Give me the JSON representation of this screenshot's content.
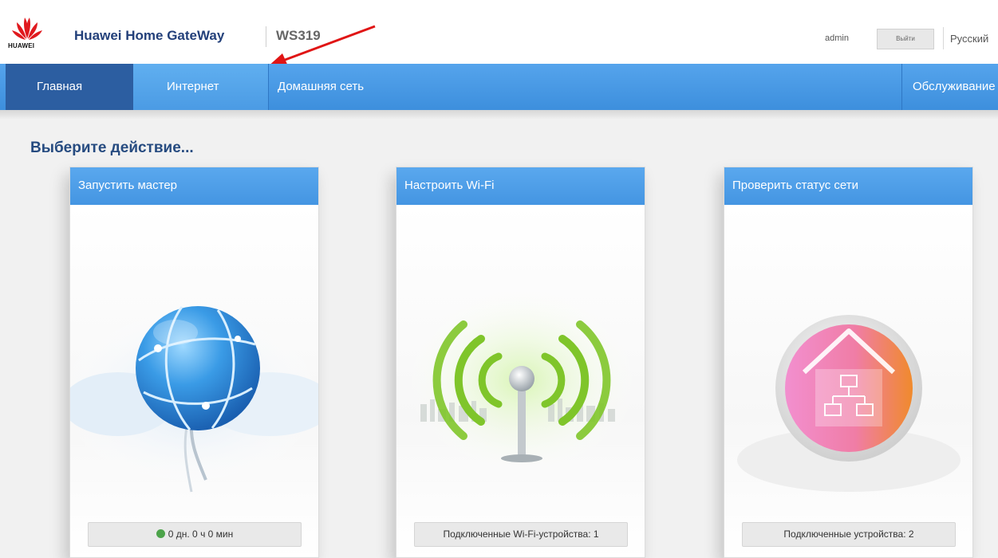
{
  "header": {
    "brand_title": "Huawei Home GateWay",
    "model": "WS319",
    "logo_text": "HUAWEI",
    "user": "admin",
    "logout_label": "Выйти",
    "language": "Русский"
  },
  "nav": {
    "items": [
      {
        "label": "Главная",
        "active": true
      },
      {
        "label": "Интернет"
      },
      {
        "label": "Домашняя сеть"
      },
      {
        "label": "Обслуживание"
      }
    ]
  },
  "main": {
    "title": "Выберите действие...",
    "cards": [
      {
        "title": "Запустить мастер",
        "status": "0 дн. 0 ч 0 мин",
        "icon": "globe-icon"
      },
      {
        "title": "Настроить Wi-Fi",
        "status": "Подключенные Wi-Fi-устройства: 1",
        "icon": "wifi-antenna-icon"
      },
      {
        "title": "Проверить статус сети",
        "status": "Подключенные устройства: 2",
        "icon": "home-network-icon"
      }
    ]
  },
  "colors": {
    "nav_blue": "#4195e2",
    "nav_active": "#2c5ea1",
    "title_blue": "#264b80",
    "status_green": "#4ca34a"
  }
}
